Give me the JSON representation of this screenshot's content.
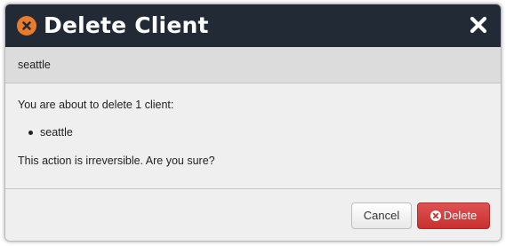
{
  "dialog": {
    "title": "Delete Client",
    "title_icon": "close-circle-icon",
    "close_icon": "close-icon"
  },
  "subheader": {
    "text": "seattle"
  },
  "body": {
    "intro": "You are about to delete 1 client:",
    "clients": [
      "seattle"
    ],
    "warning": "This action is irreversible. Are you sure?"
  },
  "footer": {
    "cancel_label": "Cancel",
    "delete_label": "Delete",
    "delete_icon": "remove-circle-icon"
  },
  "colors": {
    "header_bg": "#222b35",
    "title_icon": "#e87c2c",
    "delete_button": "#c8302e"
  }
}
